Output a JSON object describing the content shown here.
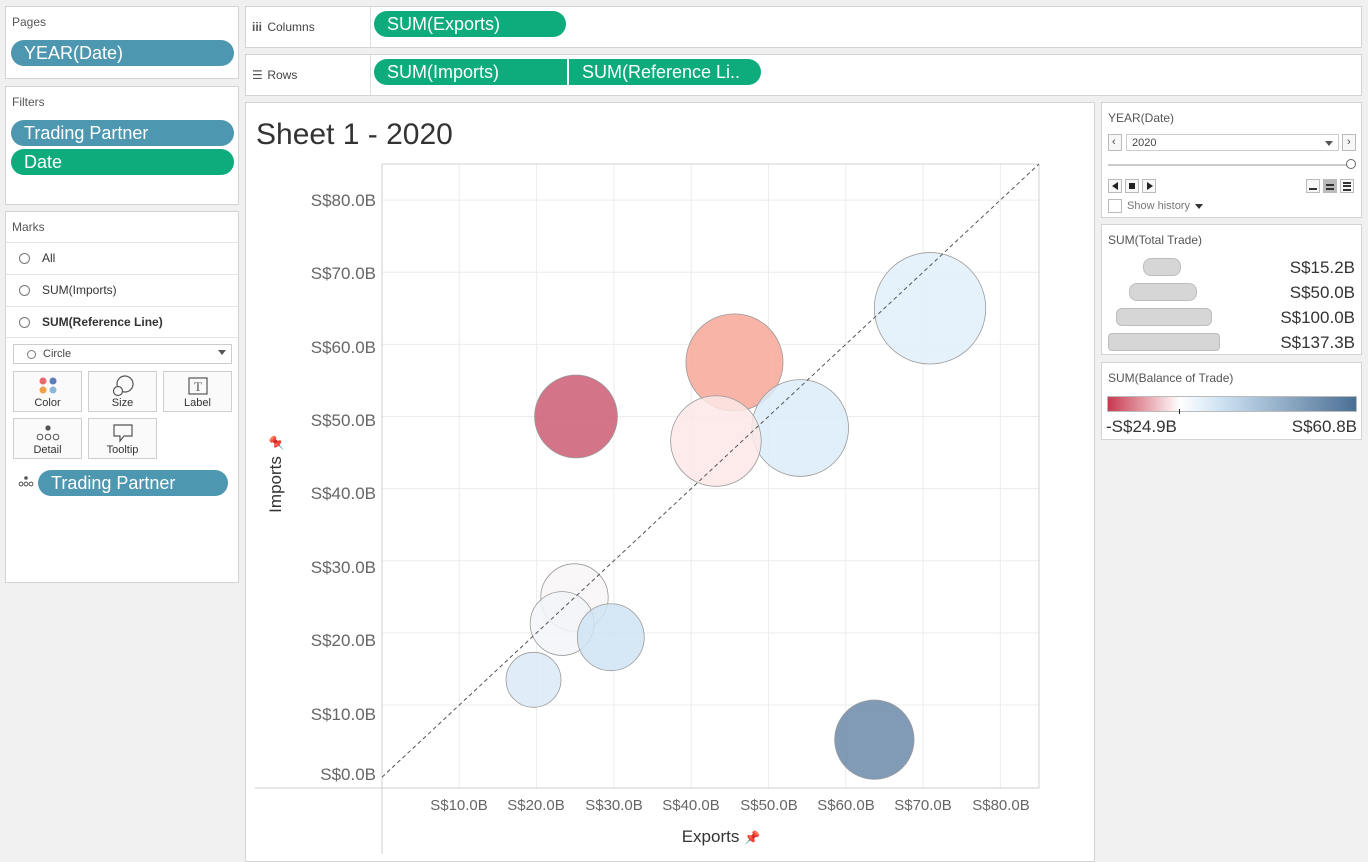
{
  "pages": {
    "title": "Pages",
    "pill": "YEAR(Date)"
  },
  "filters": {
    "title": "Filters",
    "pills": [
      "Trading Partner",
      "Date"
    ]
  },
  "marks": {
    "title": "Marks",
    "rows": [
      "All",
      "SUM(Imports)",
      "SUM(Reference Line)"
    ],
    "mark_type": "Circle",
    "buttons": [
      "Color",
      "Size",
      "Label",
      "Detail",
      "Tooltip"
    ],
    "detail_pill": "Trading Partner"
  },
  "shelves": {
    "columns_label": "Columns",
    "columns_pill": "SUM(Exports)",
    "rows_label": "Rows",
    "rows_pills": [
      "SUM(Imports)",
      "SUM(Reference Li.."
    ]
  },
  "sheet": {
    "title": "Sheet 1 - 2020"
  },
  "page_control": {
    "title": "YEAR(Date)",
    "value": "2020",
    "show_history": "Show history"
  },
  "size_legend": {
    "title": "SUM(Total Trade)",
    "items": [
      "S$15.2B",
      "S$50.0B",
      "S$100.0B",
      "S$137.3B"
    ]
  },
  "color_legend": {
    "title": "SUM(Balance of Trade)",
    "min": "-S$24.9B",
    "max": "S$60.8B",
    "colors": [
      "#c9394f",
      "#ffffff",
      "#4b6f94"
    ]
  },
  "chart_data": {
    "type": "scatter",
    "xlabel": "Exports",
    "ylabel": "Imports",
    "xlim": [
      0,
      85
    ],
    "ylim": [
      -1.5,
      85
    ],
    "x_ticks": [
      "S$10.0B",
      "S$20.0B",
      "S$30.0B",
      "S$40.0B",
      "S$50.0B",
      "S$60.0B",
      "S$70.0B",
      "S$80.0B"
    ],
    "y_ticks": [
      "S$80.0B",
      "S$70.0B",
      "S$60.0B",
      "S$50.0B",
      "S$40.0B",
      "S$30.0B",
      "S$20.0B",
      "S$10.0B",
      "S$0.0B"
    ],
    "reference_line": "y = x",
    "points": [
      {
        "x": 70.9,
        "y": 65.0,
        "total_trade": 135.9,
        "color": "#e0f0fa"
      },
      {
        "x": 45.6,
        "y": 57.5,
        "total_trade": 103.1,
        "color": "#f7a798"
      },
      {
        "x": 25.1,
        "y": 50.0,
        "total_trade": 75.1,
        "color": "#cc5c73"
      },
      {
        "x": 54.1,
        "y": 48.4,
        "total_trade": 102.5,
        "color": "#dbecf8"
      },
      {
        "x": 43.2,
        "y": 46.6,
        "total_trade": 89.8,
        "color": "#fbe7e6"
      },
      {
        "x": 24.9,
        "y": 24.9,
        "total_trade": 49.8,
        "color": "#f8f6f7"
      },
      {
        "x": 23.3,
        "y": 21.3,
        "total_trade": 44.6,
        "color": "#f2f4f8"
      },
      {
        "x": 29.6,
        "y": 19.4,
        "total_trade": 49.0,
        "color": "#cfe3f3"
      },
      {
        "x": 19.6,
        "y": 13.5,
        "total_trade": 33.1,
        "color": "#dbeaf8"
      },
      {
        "x": 63.7,
        "y": 5.2,
        "total_trade": 68.9,
        "color": "#6b89aa"
      }
    ]
  }
}
